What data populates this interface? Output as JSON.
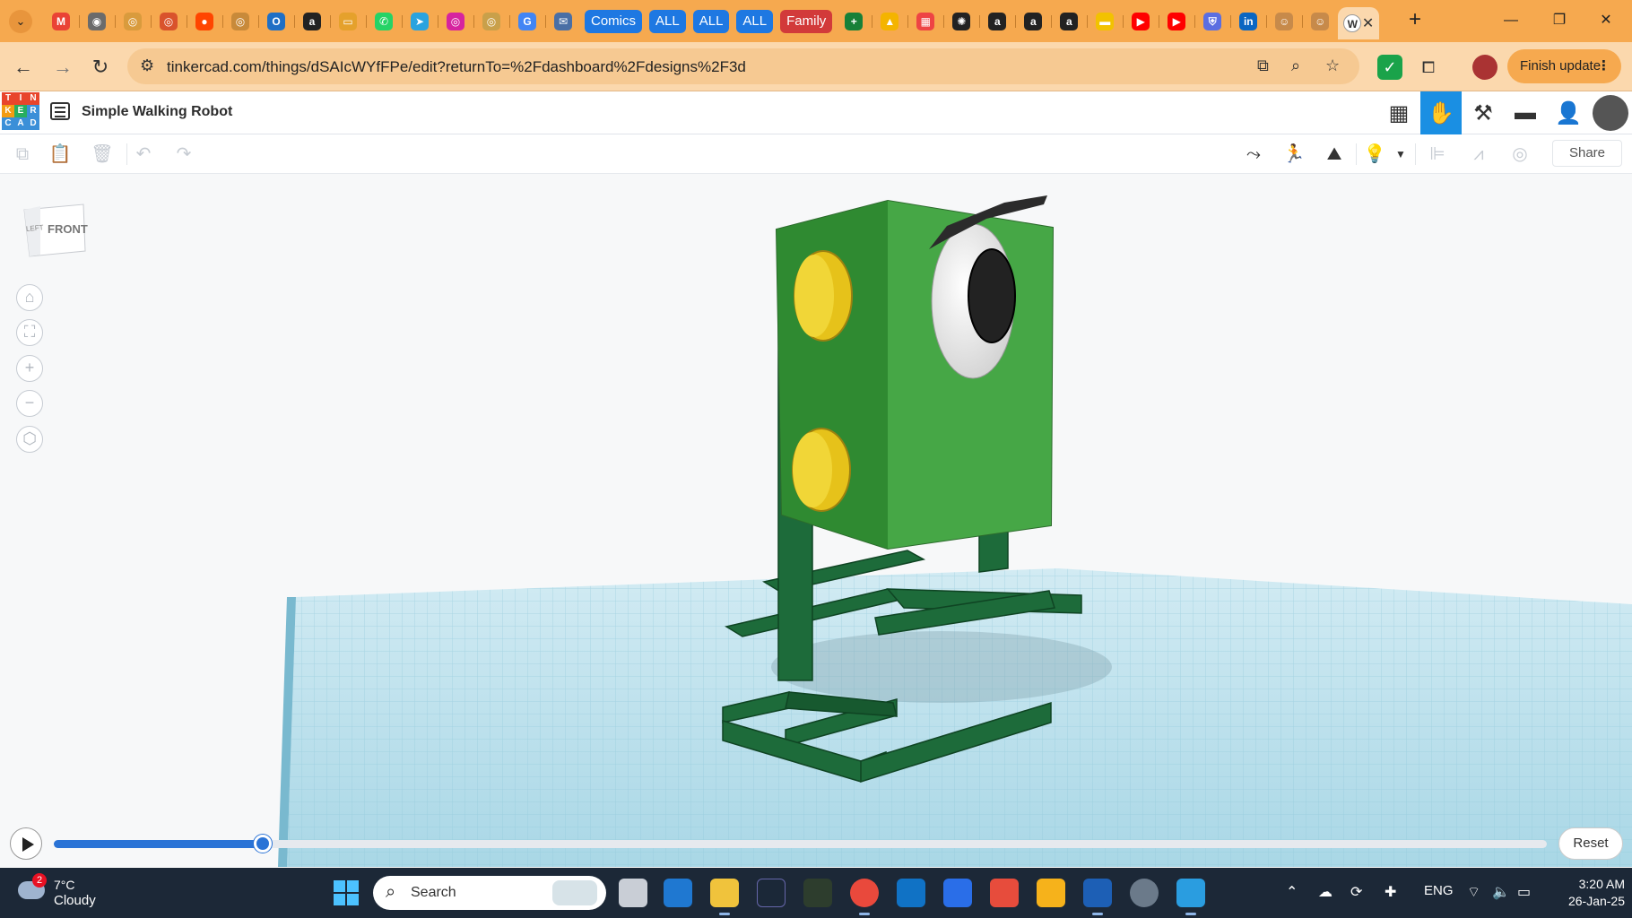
{
  "browser": {
    "tabs": [
      {
        "icon": "gmail-icon",
        "color": "#ea4335",
        "glyph": "M"
      },
      {
        "icon": "globe-icon",
        "color": "#6b6b6b",
        "glyph": "◉"
      },
      {
        "icon": "site-icon",
        "color": "#d99b3d",
        "glyph": "◎"
      },
      {
        "icon": "site-icon",
        "color": "#d9532c",
        "glyph": "◎"
      },
      {
        "icon": "reddit-icon",
        "color": "#ff4500",
        "glyph": "●"
      },
      {
        "icon": "site-icon",
        "color": "#c88a3a",
        "glyph": "◎"
      },
      {
        "icon": "outlook-icon",
        "color": "#1f6fc5",
        "glyph": "O"
      },
      {
        "icon": "amazon-icon",
        "color": "#222222",
        "glyph": "a"
      },
      {
        "icon": "site-icon",
        "color": "#e5a12c",
        "glyph": "▭"
      },
      {
        "icon": "whatsapp-icon",
        "color": "#25d366",
        "glyph": "✆"
      },
      {
        "icon": "telegram-icon",
        "color": "#2aa3df",
        "glyph": "➤"
      },
      {
        "icon": "instagram-icon",
        "color": "#d6249f",
        "glyph": "◎"
      },
      {
        "icon": "site-icon",
        "color": "#c9a04a",
        "glyph": "◎"
      },
      {
        "icon": "translate-icon",
        "color": "#4285f4",
        "glyph": "G"
      },
      {
        "icon": "mail-icon",
        "color": "#4a6fa5",
        "glyph": "✉"
      }
    ],
    "labeled_tabs": {
      "comics": "Comics",
      "all1": "ALL",
      "all2": "ALL",
      "all3": "ALL",
      "family": "Family"
    },
    "tabs2": [
      {
        "icon": "sheets-icon",
        "color": "#188038",
        "glyph": "+"
      },
      {
        "icon": "drive-icon",
        "color": "#f4b400",
        "glyph": "▲"
      },
      {
        "icon": "tinkercad-icon",
        "color": "#e44",
        "glyph": "▦"
      },
      {
        "icon": "chatgpt-icon",
        "color": "#222222",
        "glyph": "✺"
      },
      {
        "icon": "amazon-icon",
        "color": "#222222",
        "glyph": "a"
      },
      {
        "icon": "amazon-icon",
        "color": "#222222",
        "glyph": "a"
      },
      {
        "icon": "amazon-icon",
        "color": "#222222",
        "glyph": "a"
      },
      {
        "icon": "site-icon",
        "color": "#f2c200",
        "glyph": "▬"
      },
      {
        "icon": "youtube-icon",
        "color": "#ff0000",
        "glyph": "▶"
      },
      {
        "icon": "youtube-icon",
        "color": "#ff0000",
        "glyph": "▶"
      },
      {
        "icon": "shield-icon",
        "color": "#5b6ee1",
        "glyph": "⛨"
      },
      {
        "icon": "linkedin-icon",
        "color": "#0a66c2",
        "glyph": "in"
      },
      {
        "icon": "site-icon",
        "color": "#c78a4a",
        "glyph": "☺"
      },
      {
        "icon": "site-icon",
        "color": "#c78a4a",
        "glyph": "☺"
      }
    ],
    "active_tab_glyph": "W",
    "url": "tinkercad.com/things/dSAIcWYfFPe/edit?returnTo=%2Fdashboard%2Fdesigns%2F3d",
    "finish_update": "Finish update"
  },
  "tinkercad": {
    "logo_letters": [
      "T",
      "I",
      "N",
      "K",
      "E",
      "R",
      "C",
      "A",
      "D"
    ],
    "logo_colors": [
      "#e8452c",
      "#e8452c",
      "#e8452c",
      "#f39c12",
      "#27ae60",
      "#3a8fd8",
      "#3a8fd8",
      "#3a8fd8",
      "#3a8fd8"
    ],
    "design_title": "Simple Walking Robot",
    "share_label": "Share",
    "viewcube": {
      "left": "LEFT",
      "front": "FRONT"
    },
    "timeline": {
      "progress": 0.14,
      "reset_label": "Reset"
    }
  },
  "taskbar": {
    "weather": {
      "badge": "2",
      "temp": "7°C",
      "condition": "Cloudy"
    },
    "search_placeholder": "Search",
    "tray": {
      "lang": "ENG"
    },
    "clock": {
      "time": "3:20 AM",
      "date": "26-Jan-25"
    }
  }
}
